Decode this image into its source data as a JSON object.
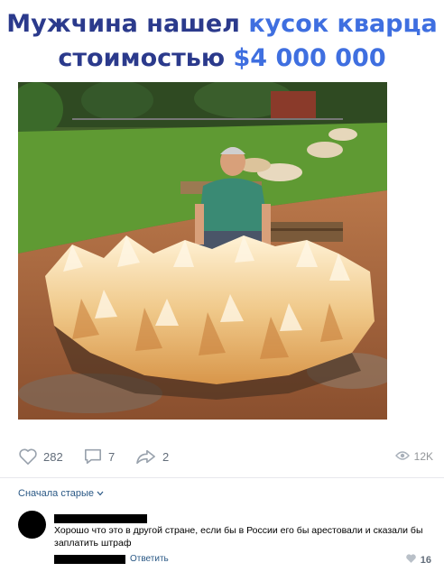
{
  "meme": {
    "line1_dark": "Мужчина нашел ",
    "line1_light": "кусок кварца",
    "line2_dark": "стоимостью ",
    "line2_light": "$4 000 000"
  },
  "post": {
    "likes": "282",
    "comments": "7",
    "shares": "2",
    "views": "12K"
  },
  "comments_section": {
    "sort_label": "Сначала старые",
    "items": [
      {
        "text": "Хорошо что это в другой стране, если бы в России его бы арестовали и сказали бы заплатить штраф",
        "reply_label": "Ответить",
        "likes": "16"
      }
    ]
  },
  "icons": {
    "like": "heart-icon",
    "comment": "comment-bubble-icon",
    "share": "share-arrow-icon",
    "views": "eye-icon",
    "sort": "chevron-down-icon"
  },
  "colors": {
    "headline_dark": "#2b3a8c",
    "headline_light": "#3f6fe0",
    "link": "#2a5885",
    "muted": "#626d7a"
  }
}
